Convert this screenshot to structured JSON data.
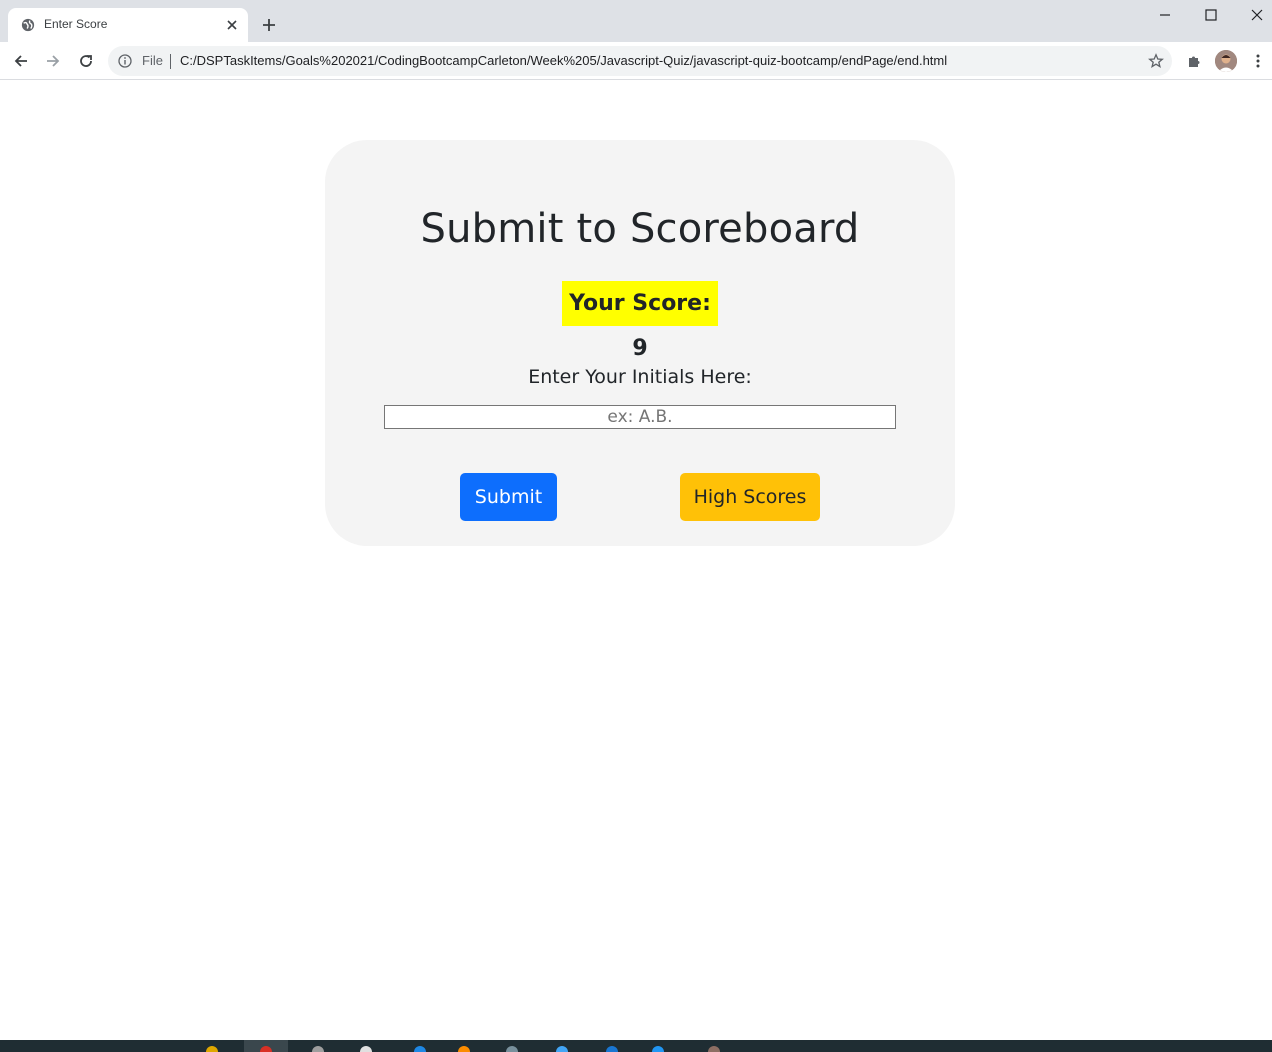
{
  "browser": {
    "tab_title": "Enter Score",
    "file_label": "File",
    "url": "C:/DSPTaskItems/Goals%202021/CodingBootcampCarleton/Week%205/Javascript-Quiz/javascript-quiz-bootcamp/endPage/end.html"
  },
  "page": {
    "heading": "Submit to Scoreboard",
    "score_text": "Your Score: 9",
    "initials_label": "Enter Your Initials Here:",
    "initials_placeholder": "ex: A.B.",
    "initials_value": "",
    "submit_label": "Submit",
    "high_scores_label": "High Scores"
  },
  "colors": {
    "submit_button": "#0d6efd",
    "high_scores_button": "#ffc107",
    "score_highlight": "#ffff00",
    "card_background": "#f4f4f4"
  },
  "icons": {
    "tab_favicon": "globe-icon",
    "tab_close": "close-icon",
    "new_tab": "plus-icon",
    "back": "back-arrow-icon",
    "forward": "forward-arrow-icon",
    "reload": "reload-icon",
    "site_info": "info-icon",
    "bookmark": "star-icon",
    "extensions": "puzzle-icon",
    "profile": "avatar",
    "menu": "kebab-menu-icon"
  }
}
